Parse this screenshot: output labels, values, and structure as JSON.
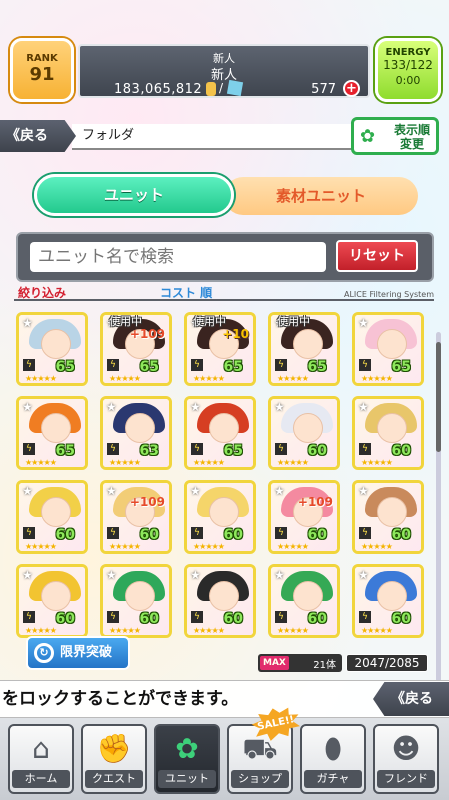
{
  "header": {
    "rank_label": "RANK",
    "rank_value": "91",
    "name_line1": "新人",
    "name_line2": "新人",
    "money": "183,065,812",
    "slash": "/",
    "gems": "577",
    "energy_label": "ENERGY",
    "energy_value": "133/122",
    "energy_timer": "0:00"
  },
  "folder": {
    "back_label": "《戻る",
    "title": "フォルダ",
    "sort_label_1": "表示順",
    "sort_label_2": "変更"
  },
  "tabs": {
    "unit": "ユニット",
    "material": "素材ユニット"
  },
  "search": {
    "placeholder": "ユニット名で検索",
    "reset_label": "リセット"
  },
  "filter": {
    "filter_label": "絞り込み",
    "cost_label": "コスト 順",
    "system_label": "ALICE Filtering System"
  },
  "units": [
    {
      "level": "65",
      "in_use": "",
      "plus": "",
      "hair": "#b9d4e6"
    },
    {
      "level": "65",
      "in_use": "使用中",
      "plus": "+109",
      "hair": "#3a2420"
    },
    {
      "level": "65",
      "in_use": "使用中",
      "plus": "+10",
      "hair": "#3a2420"
    },
    {
      "level": "65",
      "in_use": "使用中",
      "plus": "",
      "hair": "#3a2420"
    },
    {
      "level": "65",
      "in_use": "",
      "plus": "",
      "hair": "#f7c2d4"
    },
    {
      "level": "65",
      "in_use": "",
      "plus": "",
      "hair": "#f07d22"
    },
    {
      "level": "63",
      "in_use": "",
      "plus": "",
      "hair": "#2b3870"
    },
    {
      "level": "65",
      "in_use": "",
      "plus": "",
      "hair": "#d63e22"
    },
    {
      "level": "60",
      "in_use": "",
      "plus": "",
      "hair": "#e6e9f2"
    },
    {
      "level": "60",
      "in_use": "",
      "plus": "",
      "hair": "#e8c66a"
    },
    {
      "level": "60",
      "in_use": "",
      "plus": "",
      "hair": "#f2d048"
    },
    {
      "level": "60",
      "in_use": "",
      "plus": "+109",
      "hair": "#f2cd76"
    },
    {
      "level": "60",
      "in_use": "",
      "plus": "",
      "hair": "#f5d56a"
    },
    {
      "level": "60",
      "in_use": "",
      "plus": "+109",
      "hair": "#f48aa0"
    },
    {
      "level": "60",
      "in_use": "",
      "plus": "",
      "hair": "#c98a5c"
    },
    {
      "level": "60",
      "in_use": "",
      "plus": "",
      "hair": "#f2c431"
    },
    {
      "level": "60",
      "in_use": "",
      "plus": "",
      "hair": "#2ea85a"
    },
    {
      "level": "60",
      "in_use": "",
      "plus": "",
      "hair": "#2a2a2a"
    },
    {
      "level": "60",
      "in_use": "",
      "plus": "",
      "hair": "#35a955"
    },
    {
      "level": "60",
      "in_use": "",
      "plus": "",
      "hair": "#3c7ad8"
    }
  ],
  "limit_break_label": "限界突破",
  "max_badge": {
    "label": "MAX",
    "count": "21体"
  },
  "unit_count": "2047/2085",
  "ticker_text": "をロックすることができます。",
  "back_bottom_label": "《戻る",
  "sale_label": "SALE!!",
  "nav": [
    {
      "label": "ホーム",
      "icon": "home-icon"
    },
    {
      "label": "クエスト",
      "icon": "handshake-icon"
    },
    {
      "label": "ユニット",
      "icon": "rabbit-icon"
    },
    {
      "label": "ショップ",
      "icon": "cart-icon"
    },
    {
      "label": "ガチャ",
      "icon": "egg-icon"
    },
    {
      "label": "フレンド",
      "icon": "friends-icon"
    }
  ]
}
